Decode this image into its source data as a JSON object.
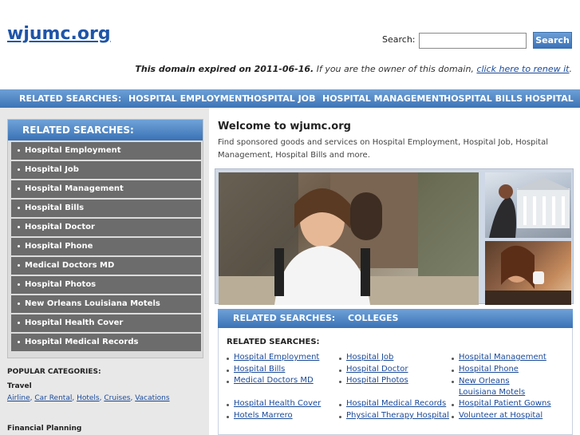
{
  "header": {
    "logo": "wjumc.org",
    "search_label": "Search:",
    "search_value": "",
    "search_button": "Search",
    "expired_bold": "This domain expired on 2011-06-16.",
    "expired_text": " If you are the owner of this domain, ",
    "expired_link": "click here to renew it",
    "expired_end": "."
  },
  "topnav": {
    "items": [
      "RELATED SEARCHES:",
      "HOSPITAL EMPLOYMENT",
      "HOSPITAL JOB",
      "HOSPITAL MANAGEMENT",
      "HOSPITAL BILLS",
      "HOSPITAL"
    ]
  },
  "sidebar": {
    "title": "RELATED SEARCHES:",
    "items": [
      "Hospital Employment",
      "Hospital Job",
      "Hospital Management",
      "Hospital Bills",
      "Hospital Doctor",
      "Hospital Phone",
      "Medical Doctors MD",
      "Hospital Photos",
      "New Orleans Louisiana Motels",
      "Hospital Health Cover",
      "Hospital Medical Records"
    ],
    "popular_title": "POPULAR CATEGORIES:",
    "travel_title": "Travel",
    "travel_links": [
      "Airline",
      "Car Rental",
      "Hotels",
      "Cruises",
      "Vacations"
    ],
    "financial_title": "Financial Planning"
  },
  "main": {
    "welcome": "Welcome to wjumc.org",
    "intro": "Find sponsored goods and services on Hospital Employment, Hospital Job, Hospital Management, Hospital Bills and more.",
    "related_bar": [
      "RELATED SEARCHES:",
      "COLLEGES"
    ],
    "related_title": "RELATED SEARCHES:",
    "related_links": [
      "Hospital Employment",
      "Hospital Job",
      "Hospital Management",
      "Hospital Bills",
      "Hospital Doctor",
      "Hospital Phone",
      "Medical Doctors MD",
      "Hospital Photos",
      "New Orleans Louisiana Motels",
      "Hospital Health Cover",
      "Hospital Medical Records",
      "Hospital Patient Gowns",
      "Hotels Marrero",
      "Physical Therapy Hospital",
      "Volunteer at Hospital"
    ]
  }
}
